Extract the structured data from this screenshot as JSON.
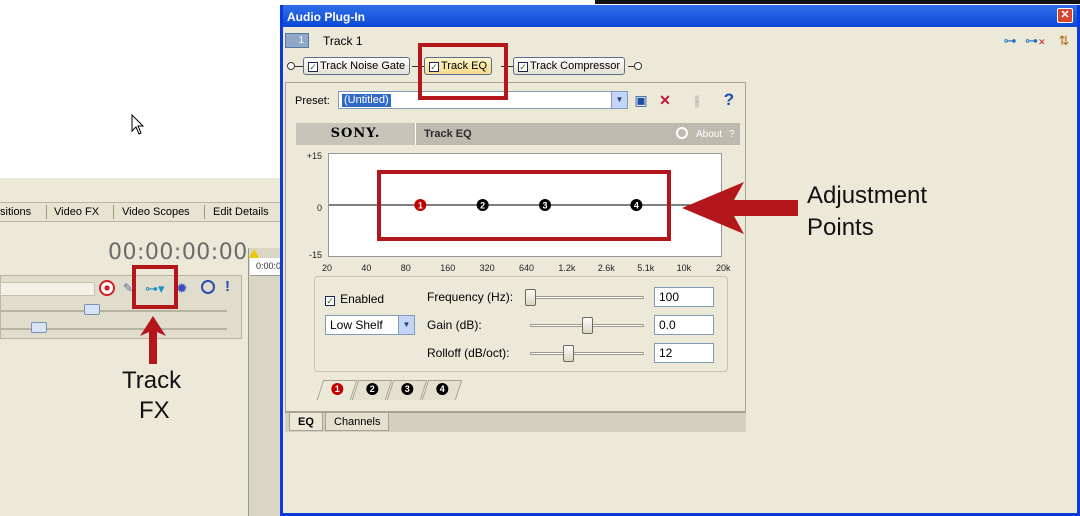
{
  "background_app": {
    "tabs": [
      "sitions",
      "Video FX",
      "Video Scopes",
      "Edit Details"
    ],
    "timecode": "00:00:00:00",
    "ruler_time": "0:00:0"
  },
  "window": {
    "title": "Audio Plug-In",
    "close_glyph": "✕",
    "track_number": "1",
    "track_label": "Track 1",
    "chain": [
      {
        "label": "Track Noise Gate",
        "checked": true
      },
      {
        "label": "Track EQ",
        "checked": true
      },
      {
        "label": "Track Compressor",
        "checked": true
      }
    ],
    "preset_label": "Preset:",
    "preset_value": "(Untitled)",
    "brand": "SONY.",
    "plugin_name": "Track EQ",
    "about_label": "About",
    "about_help": "?",
    "graph": {
      "y_labels": [
        "+15",
        "0",
        "-15"
      ],
      "x_labels": [
        "20",
        "40",
        "80",
        "160",
        "320",
        "640",
        "1.2k",
        "2.6k",
        "5.1k",
        "10k",
        "20k"
      ],
      "points": [
        {
          "band": "1",
          "freq_hz": 100,
          "color": "#c00000"
        },
        {
          "band": "2",
          "freq_hz": 300,
          "color": "#000000"
        },
        {
          "band": "3",
          "freq_hz": 900,
          "color": "#000000"
        },
        {
          "band": "4",
          "freq_hz": 4500,
          "color": "#000000"
        }
      ]
    },
    "controls": {
      "enabled_label": "Enabled",
      "enabled": true,
      "shape_value": "Low Shelf",
      "frequency_label": "Frequency (Hz):",
      "frequency_value": "100",
      "gain_label": "Gain (dB):",
      "gain_value": "0.0",
      "rolloff_label": "Rolloff (dB/oct):",
      "rolloff_value": "12"
    },
    "band_tabs": [
      "1",
      "2",
      "3",
      "4"
    ],
    "bottom_tabs": [
      "EQ",
      "Channels"
    ]
  },
  "annotations": {
    "adjustment_line1": "Adjustment",
    "adjustment_line2": "Points",
    "trackfx_line1": "Track",
    "trackfx_line2": "FX",
    "color": "#b3171c"
  }
}
